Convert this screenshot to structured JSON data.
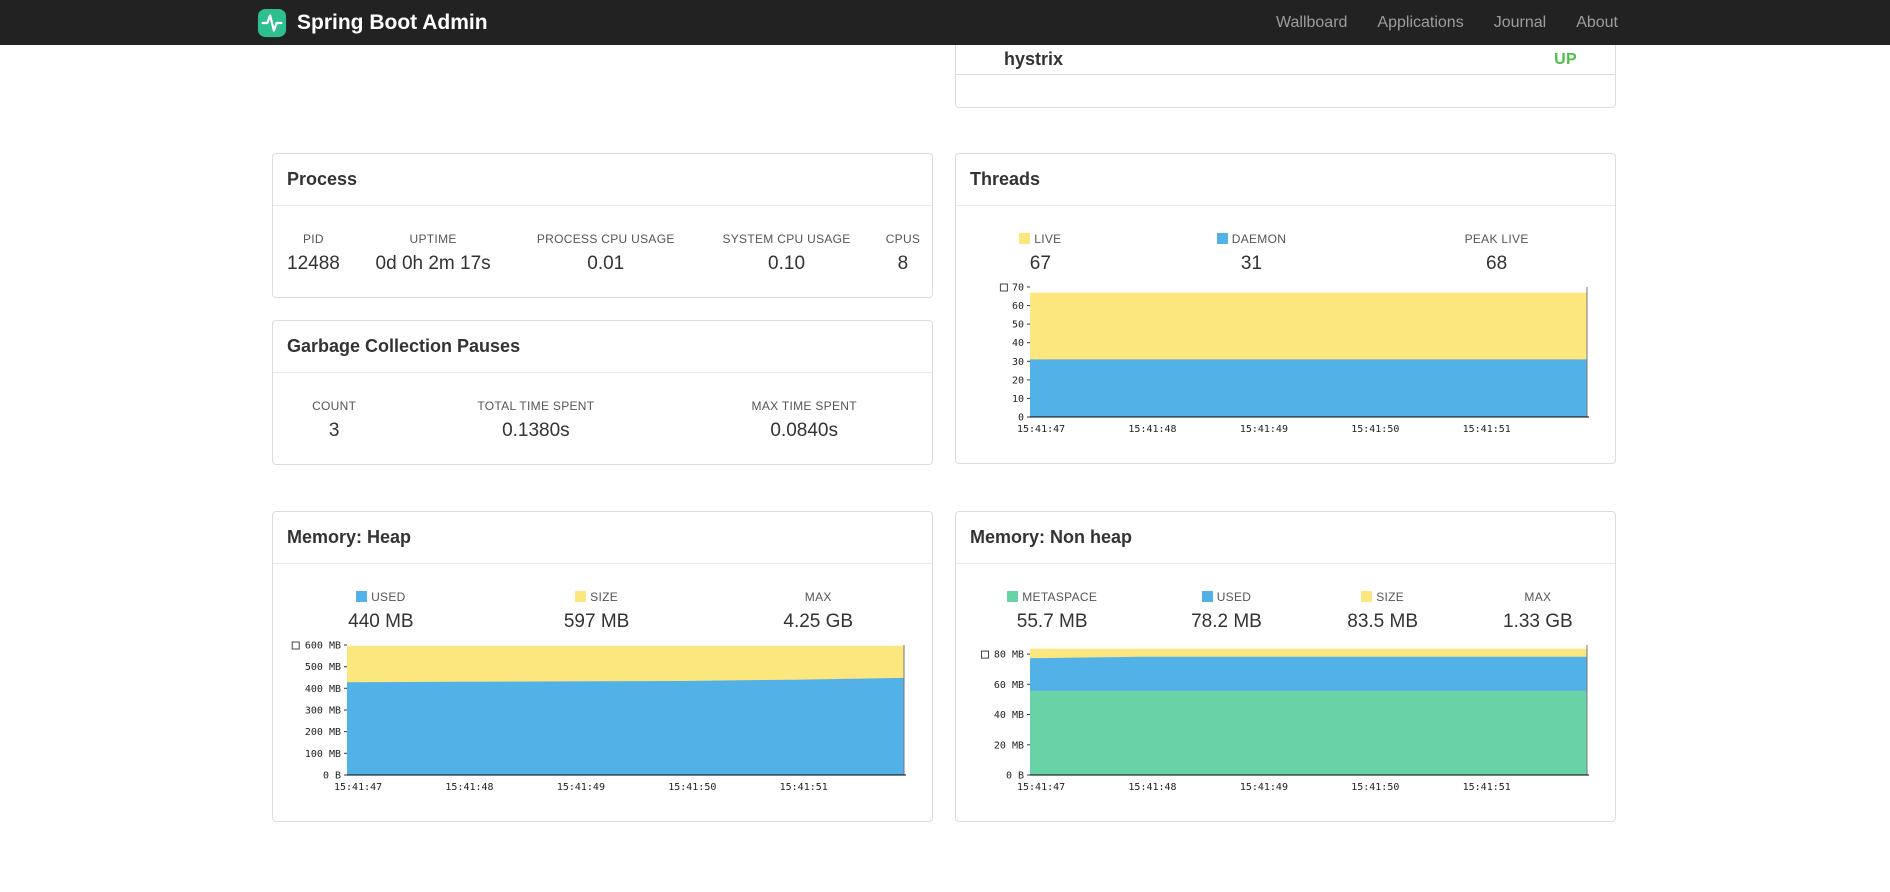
{
  "navbar": {
    "brand": "Spring Boot Admin",
    "links": [
      {
        "label": "Wallboard"
      },
      {
        "label": "Applications"
      },
      {
        "label": "Journal"
      },
      {
        "label": "About"
      }
    ]
  },
  "colors": {
    "accent_green_logo": "#2fbe8f",
    "status_up": "#4bc04b",
    "area_blue": "#52b2e8",
    "area_yellow": "#fbe77d",
    "area_green": "#68d3a6"
  },
  "application_status": {
    "name": "hystrix",
    "status": "UP",
    "status_color": "#4bc04b"
  },
  "panels": {
    "process": {
      "title": "Process",
      "stats": [
        {
          "label": "PID",
          "value": "12488"
        },
        {
          "label": "UPTIME",
          "value": "0d 0h 2m 17s"
        },
        {
          "label": "PROCESS CPU USAGE",
          "value": "0.01"
        },
        {
          "label": "SYSTEM CPU USAGE",
          "value": "0.10"
        },
        {
          "label": "CPUS",
          "value": "8"
        }
      ]
    },
    "gc": {
      "title": "Garbage Collection Pauses",
      "stats": [
        {
          "label": "COUNT",
          "value": "3"
        },
        {
          "label": "TOTAL TIME SPENT",
          "value": "0.1380s"
        },
        {
          "label": "MAX TIME SPENT",
          "value": "0.0840s"
        }
      ]
    },
    "threads": {
      "title": "Threads",
      "stats": [
        {
          "label": "LIVE",
          "value": "67",
          "swatch": "#fbe77d"
        },
        {
          "label": "DAEMON",
          "value": "31",
          "swatch": "#52b2e8"
        },
        {
          "label": "PEAK LIVE",
          "value": "68"
        }
      ]
    },
    "heap": {
      "title": "Memory: Heap",
      "stats": [
        {
          "label": "USED",
          "value": "440 MB",
          "swatch": "#52b2e8"
        },
        {
          "label": "SIZE",
          "value": "597 MB",
          "swatch": "#fbe77d"
        },
        {
          "label": "MAX",
          "value": "4.25 GB"
        }
      ]
    },
    "nonheap": {
      "title": "Memory: Non heap",
      "stats": [
        {
          "label": "METASPACE",
          "value": "55.7 MB",
          "swatch": "#68d3a6"
        },
        {
          "label": "USED",
          "value": "78.2 MB",
          "swatch": "#52b2e8"
        },
        {
          "label": "SIZE",
          "value": "83.5 MB",
          "swatch": "#fbe77d"
        },
        {
          "label": "MAX",
          "value": "1.33 GB"
        }
      ]
    }
  },
  "chart_data": [
    {
      "id": "threads",
      "type": "area",
      "title": "Threads",
      "x_ticks": [
        "15:41:47",
        "15:41:48",
        "15:41:49",
        "15:41:50",
        "15:41:51"
      ],
      "ymax": 70,
      "y_ticks": [
        {
          "value": 0,
          "label": "0"
        },
        {
          "value": 10,
          "label": "10"
        },
        {
          "value": 20,
          "label": "20"
        },
        {
          "value": 30,
          "label": "30"
        },
        {
          "value": 40,
          "label": "40"
        },
        {
          "value": 50,
          "label": "50"
        },
        {
          "value": 60,
          "label": "60"
        },
        {
          "value": 70,
          "label": "70"
        }
      ],
      "grid": false,
      "legend_position": "above",
      "series": [
        {
          "name": "LIVE",
          "color": "#fbe77d",
          "values": [
            67,
            67,
            67,
            67,
            67,
            67
          ]
        },
        {
          "name": "DAEMON",
          "color": "#52b2e8",
          "values": [
            31,
            31,
            31,
            31,
            31,
            31
          ]
        }
      ]
    },
    {
      "id": "heap",
      "type": "area",
      "title": "Memory: Heap (MB)",
      "x_ticks": [
        "15:41:47",
        "15:41:48",
        "15:41:49",
        "15:41:50",
        "15:41:51"
      ],
      "ymax": 600,
      "y_ticks": [
        {
          "value": 0,
          "label": "0 B"
        },
        {
          "value": 100,
          "label": "100 MB"
        },
        {
          "value": 200,
          "label": "200 MB"
        },
        {
          "value": 300,
          "label": "300 MB"
        },
        {
          "value": 400,
          "label": "400 MB"
        },
        {
          "value": 500,
          "label": "500 MB"
        },
        {
          "value": 600,
          "label": "600 MB"
        }
      ],
      "grid": false,
      "legend_position": "above",
      "series": [
        {
          "name": "SIZE",
          "color": "#fbe77d",
          "values": [
            597,
            597,
            597,
            597,
            597,
            597
          ]
        },
        {
          "name": "USED",
          "color": "#52b2e8",
          "values": [
            428,
            430,
            432,
            434,
            440,
            448
          ]
        }
      ]
    },
    {
      "id": "nonheap",
      "type": "area",
      "title": "Memory: Non heap (MB)",
      "x_ticks": [
        "15:41:47",
        "15:41:48",
        "15:41:49",
        "15:41:50",
        "15:41:51"
      ],
      "ymax": 86,
      "y_ticks": [
        {
          "value": 0,
          "label": "0 B"
        },
        {
          "value": 20,
          "label": "20 MB"
        },
        {
          "value": 40,
          "label": "40 MB"
        },
        {
          "value": 60,
          "label": "60 MB"
        },
        {
          "value": 80,
          "label": "80 MB"
        }
      ],
      "grid": false,
      "legend_position": "above",
      "series": [
        {
          "name": "SIZE",
          "color": "#fbe77d",
          "values": [
            83.5,
            83.5,
            83.5,
            83.5,
            83.5,
            83.5
          ]
        },
        {
          "name": "USED",
          "color": "#52b2e8",
          "values": [
            77.2,
            78.2,
            78.2,
            78.2,
            78.2,
            78.2
          ]
        },
        {
          "name": "METASPACE",
          "color": "#68d3a6",
          "values": [
            55.7,
            55.7,
            55.7,
            55.7,
            55.7,
            55.7
          ]
        }
      ]
    }
  ]
}
